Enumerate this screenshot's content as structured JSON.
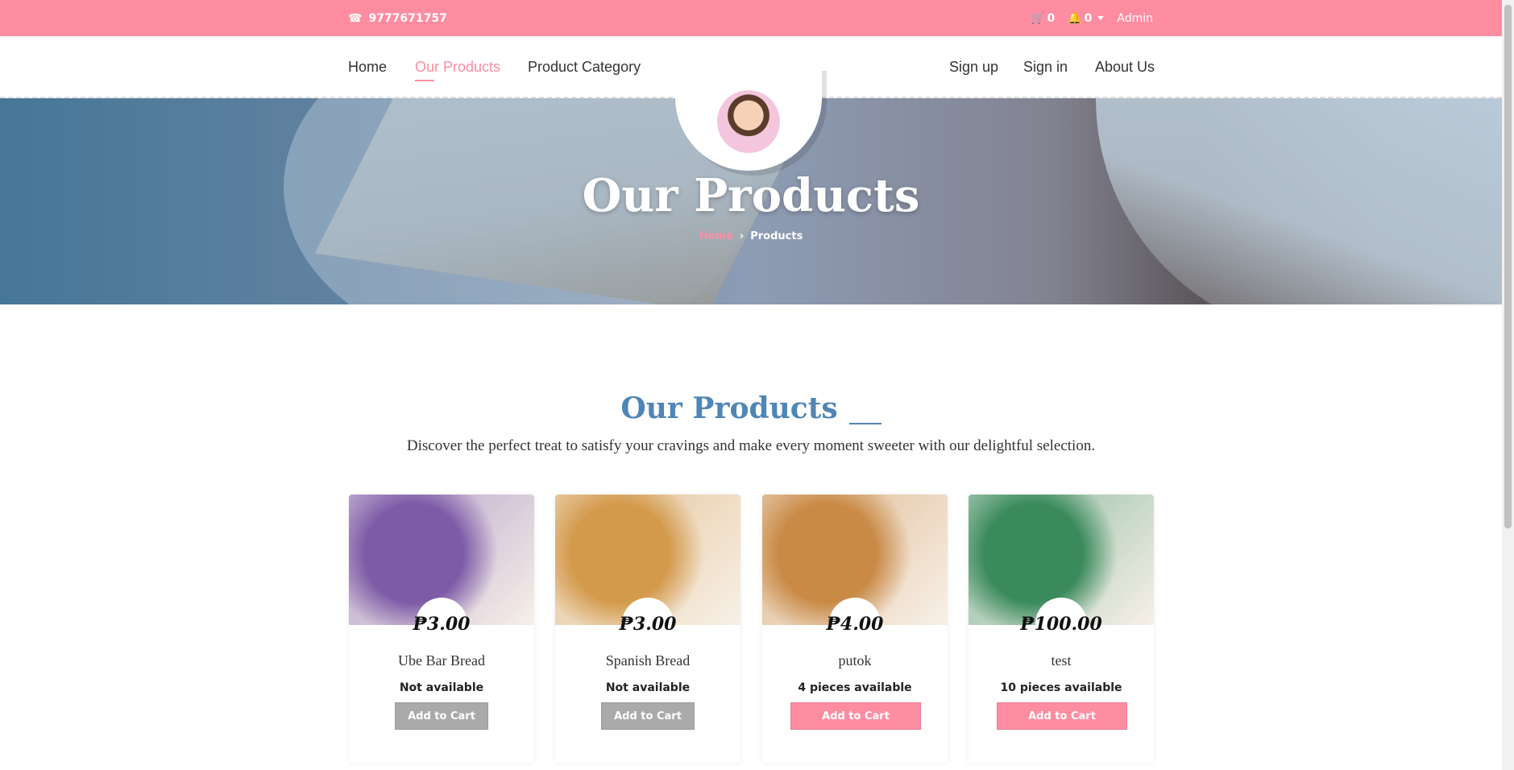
{
  "topbar": {
    "phone": "9777671757",
    "cart_count": "0",
    "notif_count": "0",
    "user": "Admin"
  },
  "nav": {
    "home": "Home",
    "products": "Our Products",
    "category": "Product Category",
    "signup": "Sign up",
    "signin": "Sign in",
    "about": "About Us"
  },
  "hero": {
    "title": "Our Products",
    "crumb_home": "Home",
    "crumb_current": "Products"
  },
  "section": {
    "title": "Our Products",
    "subtitle": "Discover the perfect treat to satisfy your cravings and make every moment sweeter with our delightful selection."
  },
  "products": [
    {
      "price": "₱3.00",
      "name": "Ube Bar Bread",
      "availability": "Not available",
      "button": "Add to Cart",
      "enabled": false,
      "color": "#7d5ba6"
    },
    {
      "price": "₱3.00",
      "name": "Spanish Bread",
      "availability": "Not available",
      "button": "Add to Cart",
      "enabled": false,
      "color": "#d39a4c"
    },
    {
      "price": "₱4.00",
      "name": "putok",
      "availability": "4 pieces available",
      "button": "Add to Cart",
      "enabled": true,
      "color": "#c98a46"
    },
    {
      "price": "₱100.00",
      "name": "test",
      "availability": "10 pieces available",
      "button": "Add to Cart",
      "enabled": true,
      "color": "#3a8a5c"
    }
  ],
  "colors": {
    "brand_pink": "#ff8da1",
    "title_blue": "#4f86b5"
  }
}
